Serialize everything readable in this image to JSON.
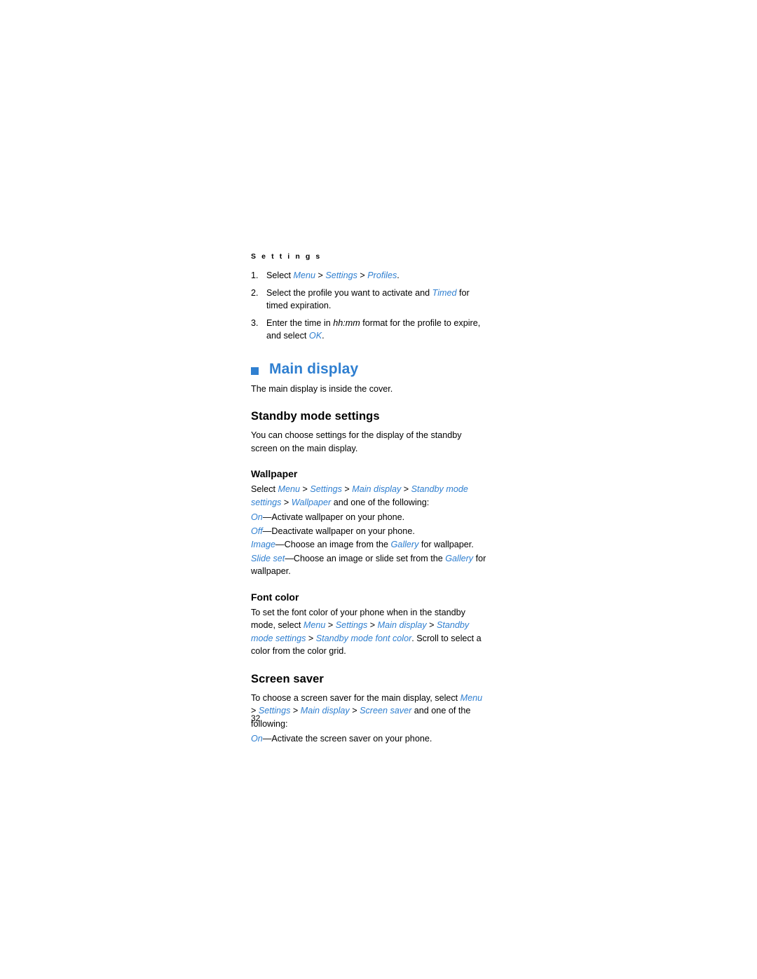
{
  "running_head": "S e t t i n g s",
  "steps": [
    {
      "num": "1.",
      "segments": [
        {
          "t": "Select ",
          "s": "plain"
        },
        {
          "t": "Menu",
          "s": "blue"
        },
        {
          "t": " > ",
          "s": "plain"
        },
        {
          "t": "Settings",
          "s": "blue"
        },
        {
          "t": " > ",
          "s": "plain"
        },
        {
          "t": "Profiles",
          "s": "blue"
        },
        {
          "t": ".",
          "s": "plain"
        }
      ]
    },
    {
      "num": "2.",
      "segments": [
        {
          "t": "Select the profile you want to activate and ",
          "s": "plain"
        },
        {
          "t": "Timed",
          "s": "blue"
        },
        {
          "t": " for timed expiration.",
          "s": "plain"
        }
      ]
    },
    {
      "num": "3.",
      "segments": [
        {
          "t": "Enter the time in ",
          "s": "plain"
        },
        {
          "t": "hh:mm",
          "s": "ital"
        },
        {
          "t": " format for the profile to expire, and select ",
          "s": "plain"
        },
        {
          "t": "OK",
          "s": "blue"
        },
        {
          "t": ".",
          "s": "plain"
        }
      ]
    }
  ],
  "main_display": {
    "heading": "Main display",
    "intro": "The main display is inside the cover.",
    "standby": {
      "heading": "Standby mode settings",
      "intro": "You can choose settings for the display of the standby screen on the main display.",
      "wallpaper": {
        "heading": "Wallpaper",
        "path_segments": [
          {
            "t": "Select ",
            "s": "plain"
          },
          {
            "t": "Menu",
            "s": "blue"
          },
          {
            "t": " > ",
            "s": "plain"
          },
          {
            "t": "Settings",
            "s": "blue"
          },
          {
            "t": " > ",
            "s": "plain"
          },
          {
            "t": "Main display",
            "s": "blue"
          },
          {
            "t": " > ",
            "s": "plain"
          },
          {
            "t": "Standby mode settings",
            "s": "blue"
          },
          {
            "t": " > ",
            "s": "plain"
          },
          {
            "t": "Wallpaper",
            "s": "blue"
          },
          {
            "t": " and one of the following:",
            "s": "plain"
          }
        ],
        "options": [
          [
            {
              "t": "On",
              "s": "blue"
            },
            {
              "t": "—Activate wallpaper on your phone.",
              "s": "plain"
            }
          ],
          [
            {
              "t": "Off",
              "s": "blue"
            },
            {
              "t": "—Deactivate wallpaper on your phone.",
              "s": "plain"
            }
          ],
          [
            {
              "t": "Image",
              "s": "blue"
            },
            {
              "t": "—Choose an image from the ",
              "s": "plain"
            },
            {
              "t": "Gallery",
              "s": "blue"
            },
            {
              "t": " for wallpaper.",
              "s": "plain"
            }
          ],
          [
            {
              "t": "Slide set",
              "s": "blue"
            },
            {
              "t": "—Choose an image or slide set from the ",
              "s": "plain"
            },
            {
              "t": "Gallery",
              "s": "blue"
            },
            {
              "t": " for wallpaper.",
              "s": "plain"
            }
          ]
        ]
      },
      "font_color": {
        "heading": "Font color",
        "segments": [
          {
            "t": "To set the font color of your phone when in the standby mode, select ",
            "s": "plain"
          },
          {
            "t": "Menu",
            "s": "blue"
          },
          {
            "t": " > ",
            "s": "plain"
          },
          {
            "t": "Settings",
            "s": "blue"
          },
          {
            "t": " > ",
            "s": "plain"
          },
          {
            "t": "Main display",
            "s": "blue"
          },
          {
            "t": " > ",
            "s": "plain"
          },
          {
            "t": "Standby mode settings",
            "s": "blue"
          },
          {
            "t": " > ",
            "s": "plain"
          },
          {
            "t": "Standby mode font color",
            "s": "blue"
          },
          {
            "t": ". Scroll to select a color from the color grid.",
            "s": "plain"
          }
        ]
      }
    },
    "screen_saver": {
      "heading": "Screen saver",
      "path_segments": [
        {
          "t": "To choose a screen saver for the main display, select ",
          "s": "plain"
        },
        {
          "t": "Menu",
          "s": "blue"
        },
        {
          "t": " > ",
          "s": "plain"
        },
        {
          "t": "Settings",
          "s": "blue"
        },
        {
          "t": " > ",
          "s": "plain"
        },
        {
          "t": "Main display",
          "s": "blue"
        },
        {
          "t": " > ",
          "s": "plain"
        },
        {
          "t": "Screen saver",
          "s": "blue"
        },
        {
          "t": " and one of the following:",
          "s": "plain"
        }
      ],
      "options": [
        [
          {
            "t": "On",
            "s": "blue"
          },
          {
            "t": "—Activate the screen saver on your phone.",
            "s": "plain"
          }
        ]
      ]
    }
  },
  "page_number": "32",
  "colors": {
    "accent": "#2f7fd0",
    "text": "#000000",
    "background": "#ffffff"
  }
}
